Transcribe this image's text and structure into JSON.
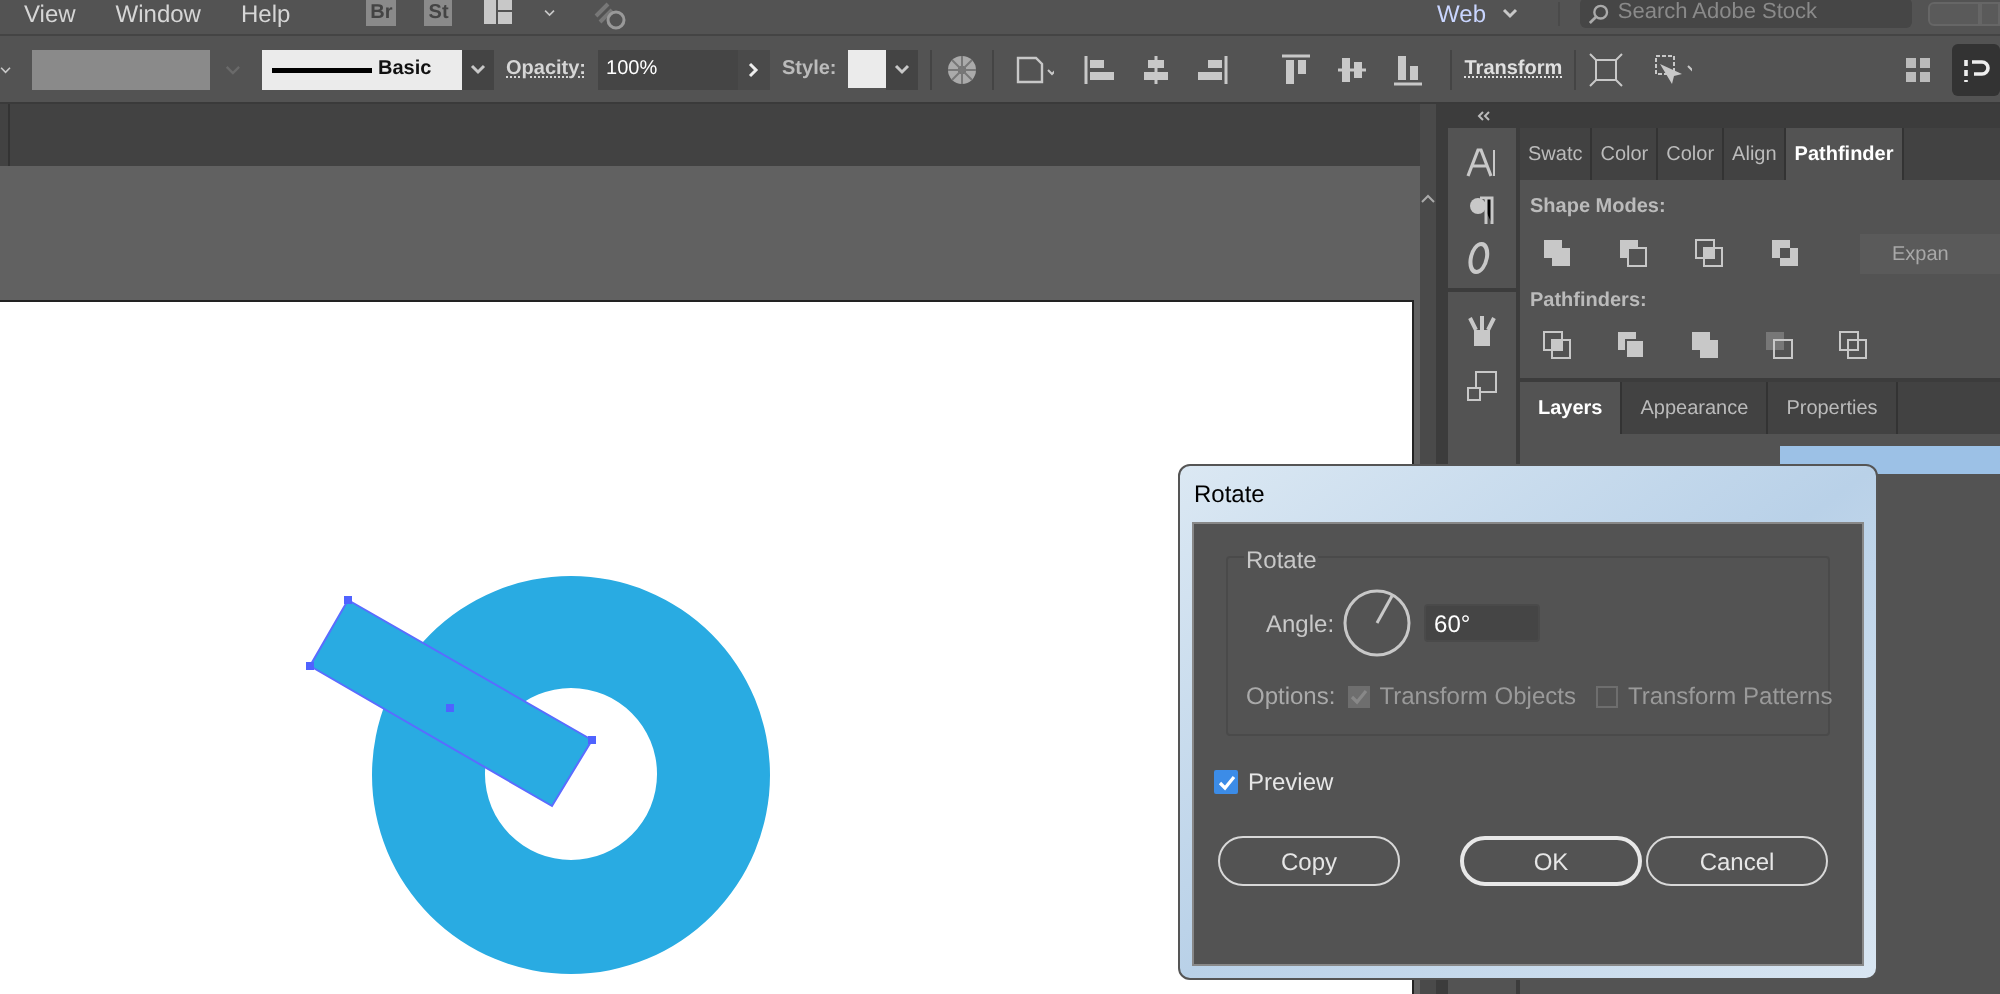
{
  "menu": [
    "View",
    "Window",
    "Help"
  ],
  "bridge_buttons": [
    "Br",
    "St"
  ],
  "workspace": "Web",
  "search": {
    "placeholder": "Search Adobe Stock"
  },
  "control_bar": {
    "stroke_style": "Basic",
    "opacity_label": "Opacity:",
    "opacity": "100%",
    "style_label": "Style:",
    "transform": "Transform"
  },
  "panel_tabs": [
    {
      "label": "Swatc",
      "selected": false
    },
    {
      "label": "Color",
      "selected": false
    },
    {
      "label": "Color",
      "selected": false
    },
    {
      "label": "Align",
      "selected": false
    },
    {
      "label": "Pathfinder",
      "selected": true
    }
  ],
  "pathfinder": {
    "shape_modes": "Shape Modes:",
    "expand": "Expan",
    "pathfinders": "Pathfinders:"
  },
  "bottom_tabs": [
    {
      "label": "Layers",
      "selected": true
    },
    {
      "label": "Appearance",
      "selected": false
    },
    {
      "label": "Properties",
      "selected": false
    }
  ],
  "dialog": {
    "title": "Rotate",
    "group": "Rotate",
    "angle_label": "Angle:",
    "angle": "60°",
    "options_label": "Options:",
    "options": [
      {
        "label": "Transform Objects",
        "checked": true
      },
      {
        "label": "Transform Patterns",
        "checked": false
      }
    ],
    "preview": {
      "label": "Preview",
      "checked": true
    },
    "buttons": [
      {
        "label": "Copy",
        "kind": "normal"
      },
      {
        "label": "OK",
        "kind": "default"
      },
      {
        "label": "Cancel",
        "kind": "normal"
      }
    ]
  }
}
